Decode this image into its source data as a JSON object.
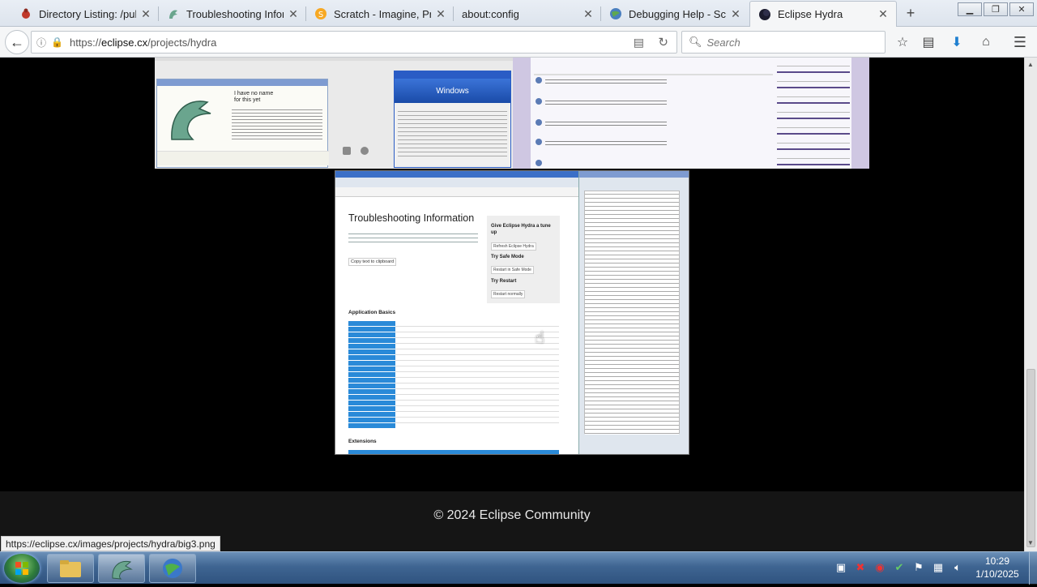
{
  "browser": {
    "tabs": [
      {
        "title": "Directory Listing: /pub",
        "icon": "bug-icon"
      },
      {
        "title": "Troubleshooting Infor",
        "icon": "hydra-icon"
      },
      {
        "title": "Scratch - Imagine, Prog",
        "icon": "scratch-icon"
      },
      {
        "title": "about:config",
        "icon": "none"
      },
      {
        "title": "Debugging Help - Scra",
        "icon": "globe-icon"
      },
      {
        "title": "Eclipse Hydra",
        "icon": "eclipse-icon"
      }
    ],
    "new_tab": "+",
    "url_prefix": "https://",
    "url_domain": "eclipse.cx",
    "url_path": "/projects/hydra",
    "search_placeholder": "Search"
  },
  "gallery": {
    "thumb3": {
      "title": "Troubleshooting Information",
      "sidebar_title": "Give Eclipse Hydra a tune up",
      "refresh_label": "Refresh Eclipse Hydra",
      "safe_mode_title": "Try Safe Mode",
      "safe_mode_btn": "Restart in Safe Mode",
      "restart_title": "Try Restart",
      "restart_btn": "Restart normally",
      "copy_btn": "Copy text to clipboard",
      "section_basics": "Application Basics",
      "section_extensions": "Extensions"
    },
    "thumb1": {
      "dialog_line1": "I have no name",
      "dialog_line2": "for this yet"
    },
    "thumb1b": {
      "title": "Windows"
    }
  },
  "footer": {
    "copyright": "© 2024 Eclipse Community"
  },
  "status_url": "https://eclipse.cx/images/projects/hydra/big3.png",
  "taskbar": {
    "time": "10:29",
    "date": "1/10/2025"
  }
}
